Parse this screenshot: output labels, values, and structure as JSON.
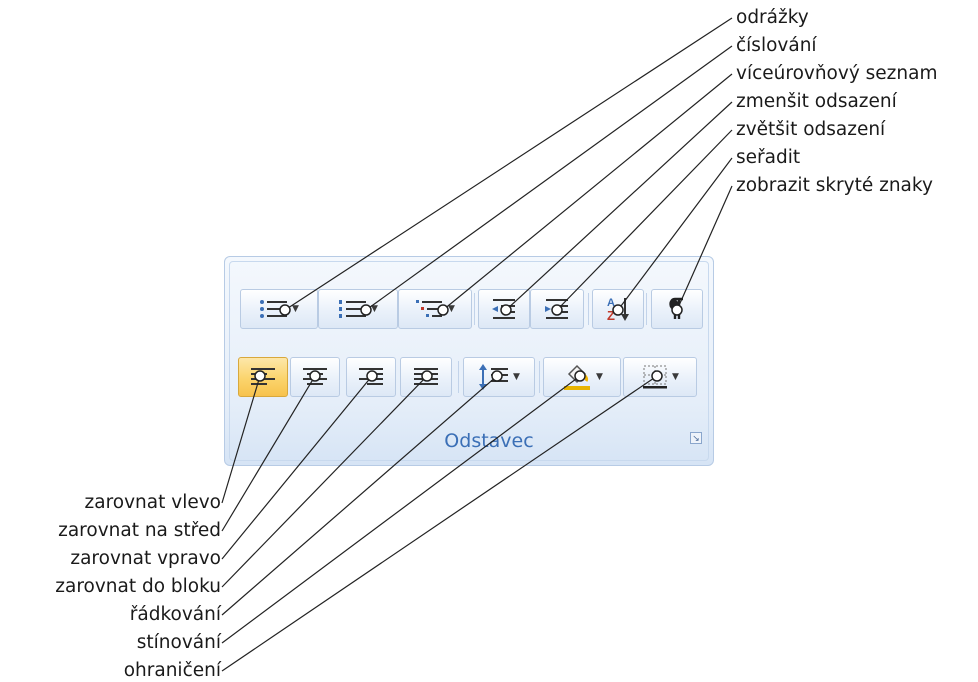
{
  "group": {
    "title": "Odstavec"
  },
  "callouts_right": [
    "odrážky",
    "číslování",
    "víceúrovňový seznam",
    "zmenšit odsazení",
    "zvětšit odsazení",
    "seřadit",
    "zobrazit skryté znaky"
  ],
  "callouts_left": [
    "zarovnat vlevo",
    "zarovnat na střed",
    "zarovnat vpravo",
    "zarovnat do bloku",
    "řádkování",
    "stínování",
    "ohraničení"
  ],
  "colors": {
    "group_title": "#3b6fb6",
    "active_button": "#fbd46c",
    "panel_border": "#b7cbe5"
  }
}
